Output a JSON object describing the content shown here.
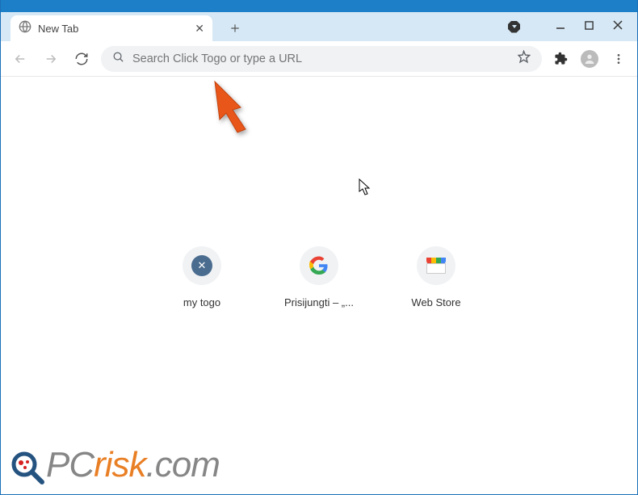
{
  "tab": {
    "title": "New Tab"
  },
  "omnibox": {
    "placeholder": "Search Click Togo or type a URL"
  },
  "shortcuts": [
    {
      "label": "my togo",
      "icon": "togo"
    },
    {
      "label": "Prisijungti – „...",
      "icon": "google"
    },
    {
      "label": "Web Store",
      "icon": "webstore"
    }
  ],
  "watermark": {
    "part1": "PC",
    "part2": "risk",
    "part3": ".com"
  }
}
